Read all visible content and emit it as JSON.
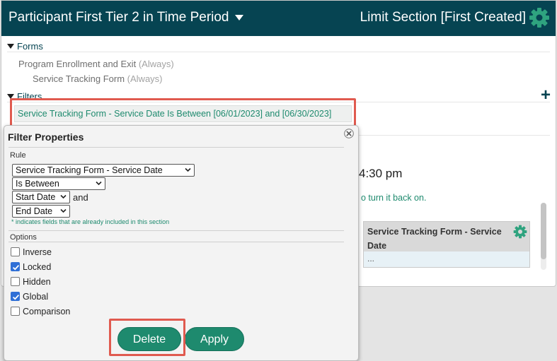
{
  "header": {
    "title": "Participant First Tier 2 in Time Period",
    "right_label": "Limit Section [First Created]"
  },
  "forms": {
    "heading": "Forms",
    "items": [
      {
        "name": "Program Enrollment and Exit",
        "note": "(Always)"
      },
      {
        "name": "Service Tracking Form",
        "note": "(Always)"
      }
    ]
  },
  "filters": {
    "heading": "Filters",
    "chip": "Service Tracking Form - Service Date Is Between [06/01/2023] and [06/30/2023]"
  },
  "background": {
    "time_fragment": "4:30 pm",
    "turn_fragment": "o turn it back on.",
    "preview_header": "Service Tracking Form - Service Date",
    "preview_cell": "..."
  },
  "dialog": {
    "title": "Filter Properties",
    "rule_label": "Rule",
    "field_select": "Service Tracking Form - Service Date",
    "operator_select": "Is Between",
    "start_select": "Start Date",
    "and_text": "and",
    "end_select": "End Date",
    "note": "* indicates fields that are already included in this section",
    "options_label": "Options",
    "options": [
      {
        "label": "Inverse",
        "checked": false
      },
      {
        "label": "Locked",
        "checked": true
      },
      {
        "label": "Hidden",
        "checked": false
      },
      {
        "label": "Global",
        "checked": true
      },
      {
        "label": "Comparison",
        "checked": false
      }
    ],
    "delete_label": "Delete",
    "apply_label": "Apply"
  },
  "colors": {
    "header_bg": "#064452",
    "accent": "#1e8a6e",
    "highlight": "#e05a4f",
    "checkbox": "#2f6fd6"
  }
}
